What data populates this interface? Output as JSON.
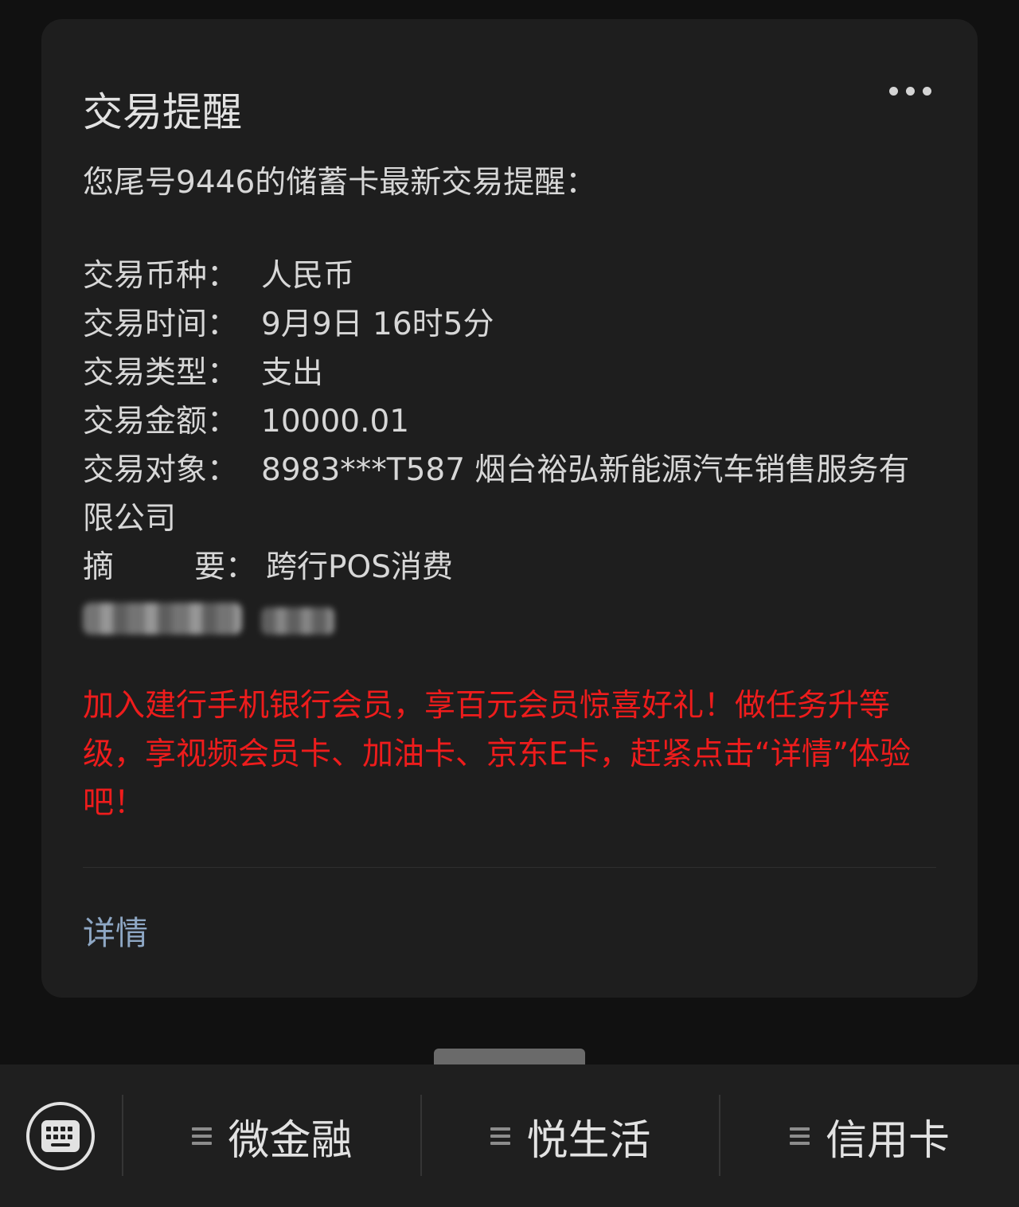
{
  "card": {
    "title": "交易提醒",
    "intro": "您尾号9446的储蓄卡最新交易提醒：",
    "fields": [
      {
        "label": "交易币种：",
        "value": "人民币"
      },
      {
        "label": "交易时间：",
        "value": "9月9日 16时5分"
      },
      {
        "label": "交易类型：",
        "value": "支出"
      },
      {
        "label": "交易金额：",
        "value": "10000.01"
      },
      {
        "label": "交易对象：",
        "value": "8983***T587 烟台裕弘新能源汽车销售服务有限公司"
      }
    ],
    "summary": {
      "label_char1": "摘",
      "label_char2": "要：",
      "value": "跨行POS消费"
    },
    "promo": "加入建行手机银行会员，享百元会员惊喜好礼！做任务升等级，享视频会员卡、加油卡、京东E卡，赶紧点击“详情”体验吧！",
    "detail_link": "详情"
  },
  "bottom_bar": {
    "menus": [
      {
        "label": "微金融",
        "icon": "menu-lines-icon"
      },
      {
        "label": "悦生活",
        "icon": "menu-lines-icon"
      },
      {
        "label": "信用卡",
        "icon": "menu-lines-icon"
      }
    ],
    "keyboard_icon": "keyboard-icon"
  },
  "colors": {
    "background": "#111111",
    "card": "#1e1e1e",
    "text": "#d7d7d7",
    "promo": "#ee1c1c",
    "link": "#8ea7c4"
  }
}
